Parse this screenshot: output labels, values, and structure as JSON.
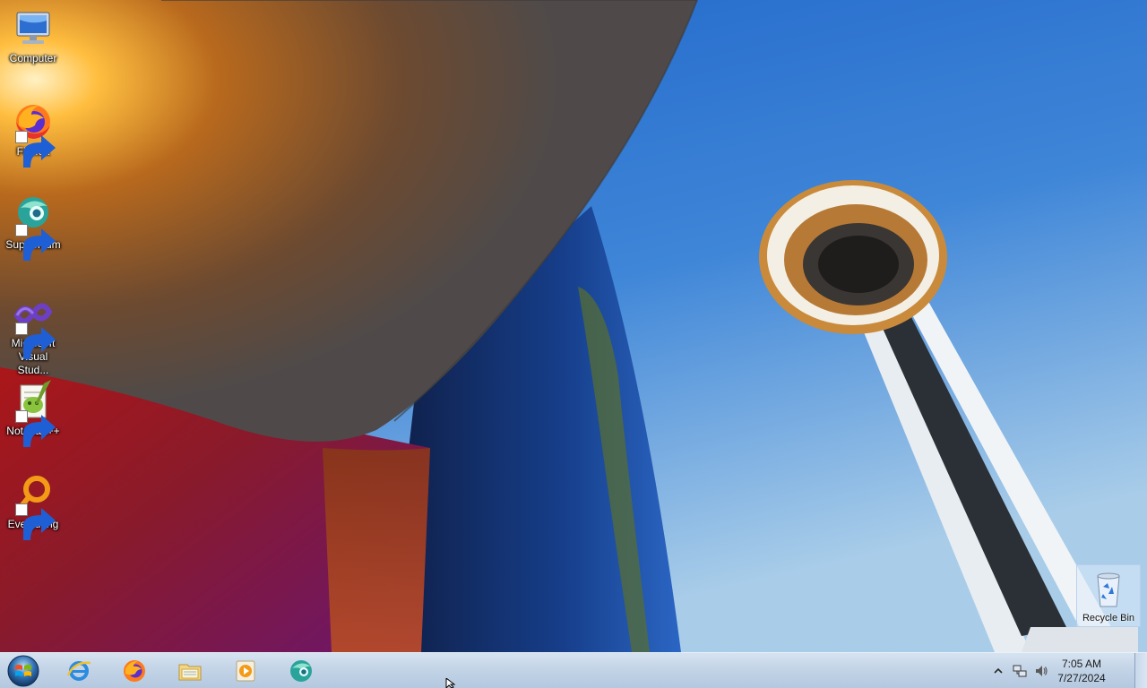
{
  "desktop": {
    "icons": [
      {
        "label": "Computer",
        "icon": "computer-icon"
      },
      {
        "label": "Firefox",
        "icon": "firefox-icon"
      },
      {
        "label": "Supermium",
        "icon": "supermium-icon"
      },
      {
        "label": "Microsoft Visual Stud...",
        "icon": "visual-studio-icon"
      },
      {
        "label": "Notepad++",
        "icon": "notepadpp-icon"
      },
      {
        "label": "Everything",
        "icon": "everything-icon"
      },
      {
        "label": "Recycle Bin",
        "icon": "recycle-bin-icon"
      }
    ]
  },
  "taskbar": {
    "start": {
      "icon": "windows-start-orb"
    },
    "pinned": [
      {
        "name": "Internet Explorer",
        "icon": "internet-explorer-icon"
      },
      {
        "name": "Firefox",
        "icon": "firefox-icon"
      },
      {
        "name": "Windows Explorer",
        "icon": "folder-icon"
      },
      {
        "name": "Windows Media Player",
        "icon": "media-player-icon"
      },
      {
        "name": "Supermium",
        "icon": "supermium-icon"
      }
    ],
    "tray": {
      "icons": [
        "show-hidden-icons-arrow",
        "network-icon",
        "volume-icon"
      ],
      "time": "7:05 AM",
      "date": "7/27/2024"
    }
  },
  "colors": {
    "taskbar": "#c3d4e7",
    "sky": "#3f86d8",
    "firefox_orange": "#ff7a1a",
    "everything_orange": "#f39a17"
  }
}
